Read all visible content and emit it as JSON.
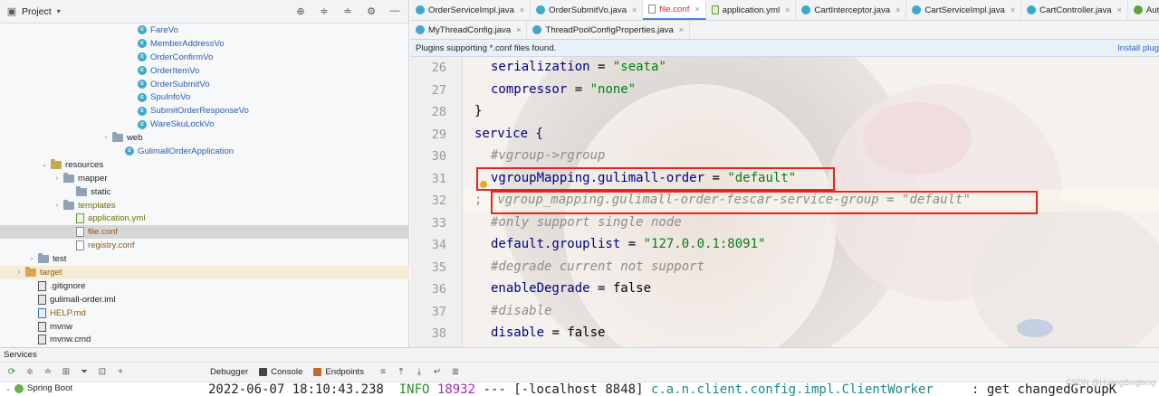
{
  "project_panel": {
    "title": "Project",
    "tree": [
      {
        "label": "FareVo",
        "indent": 152,
        "icon": "class",
        "color": "blue",
        "arrow": ""
      },
      {
        "label": "MemberAddressVo",
        "indent": 152,
        "icon": "class",
        "color": "blue",
        "arrow": ""
      },
      {
        "label": "OrderConfirmVo",
        "indent": 152,
        "icon": "class",
        "color": "blue",
        "arrow": ""
      },
      {
        "label": "OrderItemVo",
        "indent": 152,
        "icon": "class",
        "color": "blue",
        "arrow": ""
      },
      {
        "label": "OrderSubmitVo",
        "indent": 152,
        "icon": "class",
        "color": "blue",
        "arrow": ""
      },
      {
        "label": "SpuInfoVo",
        "indent": 152,
        "icon": "class",
        "color": "blue",
        "arrow": ""
      },
      {
        "label": "SubmitOrderResponseVo",
        "indent": 152,
        "icon": "class",
        "color": "blue",
        "arrow": ""
      },
      {
        "label": "WareSkuLockVo",
        "indent": 152,
        "icon": "class",
        "color": "blue",
        "arrow": ""
      },
      {
        "label": "web",
        "indent": 124,
        "icon": "folder",
        "color": "dark",
        "arrow": "›"
      },
      {
        "label": "GulimallOrderApplication",
        "indent": 138,
        "icon": "class",
        "color": "blue",
        "arrow": ""
      },
      {
        "label": "resources",
        "indent": 56,
        "icon": "folder-res",
        "color": "dark",
        "arrow": "⌄"
      },
      {
        "label": "mapper",
        "indent": 70,
        "icon": "folder",
        "color": "dark",
        "arrow": "›"
      },
      {
        "label": "static",
        "indent": 84,
        "icon": "folder",
        "color": "dark",
        "arrow": ""
      },
      {
        "label": "templates",
        "indent": 70,
        "icon": "folder",
        "color": "olive",
        "arrow": "›"
      },
      {
        "label": "application.yml",
        "indent": 84,
        "icon": "file-yml",
        "color": "olive",
        "arrow": ""
      },
      {
        "label": "file.conf",
        "indent": 84,
        "icon": "file-conf",
        "color": "brown",
        "arrow": "",
        "selected": true
      },
      {
        "label": "registry.conf",
        "indent": 84,
        "icon": "file-conf",
        "color": "brown",
        "arrow": ""
      },
      {
        "label": "test",
        "indent": 42,
        "icon": "folder",
        "color": "dark",
        "arrow": "›"
      },
      {
        "label": "target",
        "indent": 28,
        "icon": "folder-orange",
        "color": "brown",
        "arrow": "›",
        "target": true
      },
      {
        "label": ".gitignore",
        "indent": 42,
        "icon": "file-dark",
        "color": "dark",
        "arrow": ""
      },
      {
        "label": "gulimall-order.iml",
        "indent": 42,
        "icon": "file-dark",
        "color": "dark",
        "arrow": ""
      },
      {
        "label": "HELP.md",
        "indent": 42,
        "icon": "file-md",
        "color": "brown",
        "arrow": ""
      },
      {
        "label": "mvnw",
        "indent": 42,
        "icon": "file-dark",
        "color": "dark",
        "arrow": ""
      },
      {
        "label": "mvnw.cmd",
        "indent": 42,
        "icon": "file-dark",
        "color": "dark",
        "arrow": ""
      }
    ]
  },
  "tabs_row1": [
    {
      "label": "OrderServiceImpl.java",
      "icon": "class",
      "active": false
    },
    {
      "label": "OrderSubmitVo.java",
      "icon": "class",
      "active": false
    },
    {
      "label": "file.conf",
      "icon": "conf",
      "active": true,
      "red": true
    },
    {
      "label": "application.yml",
      "icon": "yml",
      "active": false
    },
    {
      "label": "CartInterceptor.java",
      "icon": "class",
      "active": false
    },
    {
      "label": "CartServiceImpl.java",
      "icon": "class",
      "active": false
    },
    {
      "label": "CartController.java",
      "icon": "class",
      "active": false
    },
    {
      "label": "Autowired.cl",
      "icon": "green",
      "active": false
    }
  ],
  "tabs_row2": [
    {
      "label": "MyThreadConfig.java",
      "icon": "class",
      "active": false
    },
    {
      "label": "ThreadPoolConfigProperties.java",
      "icon": "class",
      "active": false
    }
  ],
  "notice": {
    "message": "Plugins supporting *.conf files found.",
    "link": "Install plug"
  },
  "editor": {
    "lines": [
      {
        "num": "26",
        "indent": 2,
        "parts": [
          {
            "t": "serialization",
            "c": "k"
          },
          {
            "t": " = ",
            "c": "b"
          },
          {
            "t": "\"seata\"",
            "c": "s"
          }
        ]
      },
      {
        "num": "27",
        "indent": 2,
        "parts": [
          {
            "t": "compressor",
            "c": "k"
          },
          {
            "t": " = ",
            "c": "b"
          },
          {
            "t": "\"none\"",
            "c": "s"
          }
        ]
      },
      {
        "num": "28",
        "indent": 1,
        "parts": [
          {
            "t": "}",
            "c": "b"
          }
        ]
      },
      {
        "num": "29",
        "indent": 1,
        "parts": [
          {
            "t": "service {",
            "c": "k"
          }
        ]
      },
      {
        "num": "30",
        "indent": 2,
        "parts": [
          {
            "t": "#vgroup->rgroup",
            "c": "c"
          }
        ]
      },
      {
        "num": "31",
        "indent": 2,
        "parts": [
          {
            "t": "vgroupMapping.gulimall-order",
            "c": "k"
          },
          {
            "t": " = ",
            "c": "b"
          },
          {
            "t": "\"default\"",
            "c": "s"
          }
        ]
      },
      {
        "num": "32",
        "indent": 1,
        "parts": [
          {
            "t": ";  ",
            "c": "g"
          },
          {
            "t": "vgroup_mapping.gulimall-order-fescar-service-group = \"default\"",
            "c": "c"
          }
        ]
      },
      {
        "num": "33",
        "indent": 2,
        "parts": [
          {
            "t": "#only support single node",
            "c": "c"
          }
        ]
      },
      {
        "num": "34",
        "indent": 2,
        "parts": [
          {
            "t": "default.grouplist",
            "c": "k"
          },
          {
            "t": " = ",
            "c": "b"
          },
          {
            "t": "\"127.0.0.1:8091\"",
            "c": "s"
          }
        ]
      },
      {
        "num": "35",
        "indent": 2,
        "parts": [
          {
            "t": "#degrade current not support",
            "c": "c"
          }
        ]
      },
      {
        "num": "36",
        "indent": 2,
        "parts": [
          {
            "t": "enableDegrade",
            "c": "k"
          },
          {
            "t": " = ",
            "c": "b"
          },
          {
            "t": "false",
            "c": "b"
          }
        ]
      },
      {
        "num": "37",
        "indent": 2,
        "parts": [
          {
            "t": "#disable",
            "c": "c"
          }
        ]
      },
      {
        "num": "38",
        "indent": 2,
        "parts": [
          {
            "t": "disable",
            "c": "k"
          },
          {
            "t": " = ",
            "c": "b"
          },
          {
            "t": "false",
            "c": "b"
          }
        ]
      }
    ]
  },
  "services": {
    "label": "Services",
    "tabs": [
      "Debugger",
      "Console",
      "Endpoints"
    ],
    "tree_item": "Spring Boot",
    "console": {
      "timestamp": "2022-06-07 18:10:43.238",
      "level": "INFO",
      "pid": "18932",
      "sep": "---",
      "thread": "[-localhost_8848]",
      "logger": "c.a.n.client.config.impl.ClientWorker",
      "message": ": get changedGroupK"
    },
    "watermark": "CSDN @HuangBingbing"
  },
  "colors": {
    "accent": "#4a83d6",
    "highlight_box": "#e8251b",
    "string": "#067d17",
    "keyword": "#000080"
  }
}
